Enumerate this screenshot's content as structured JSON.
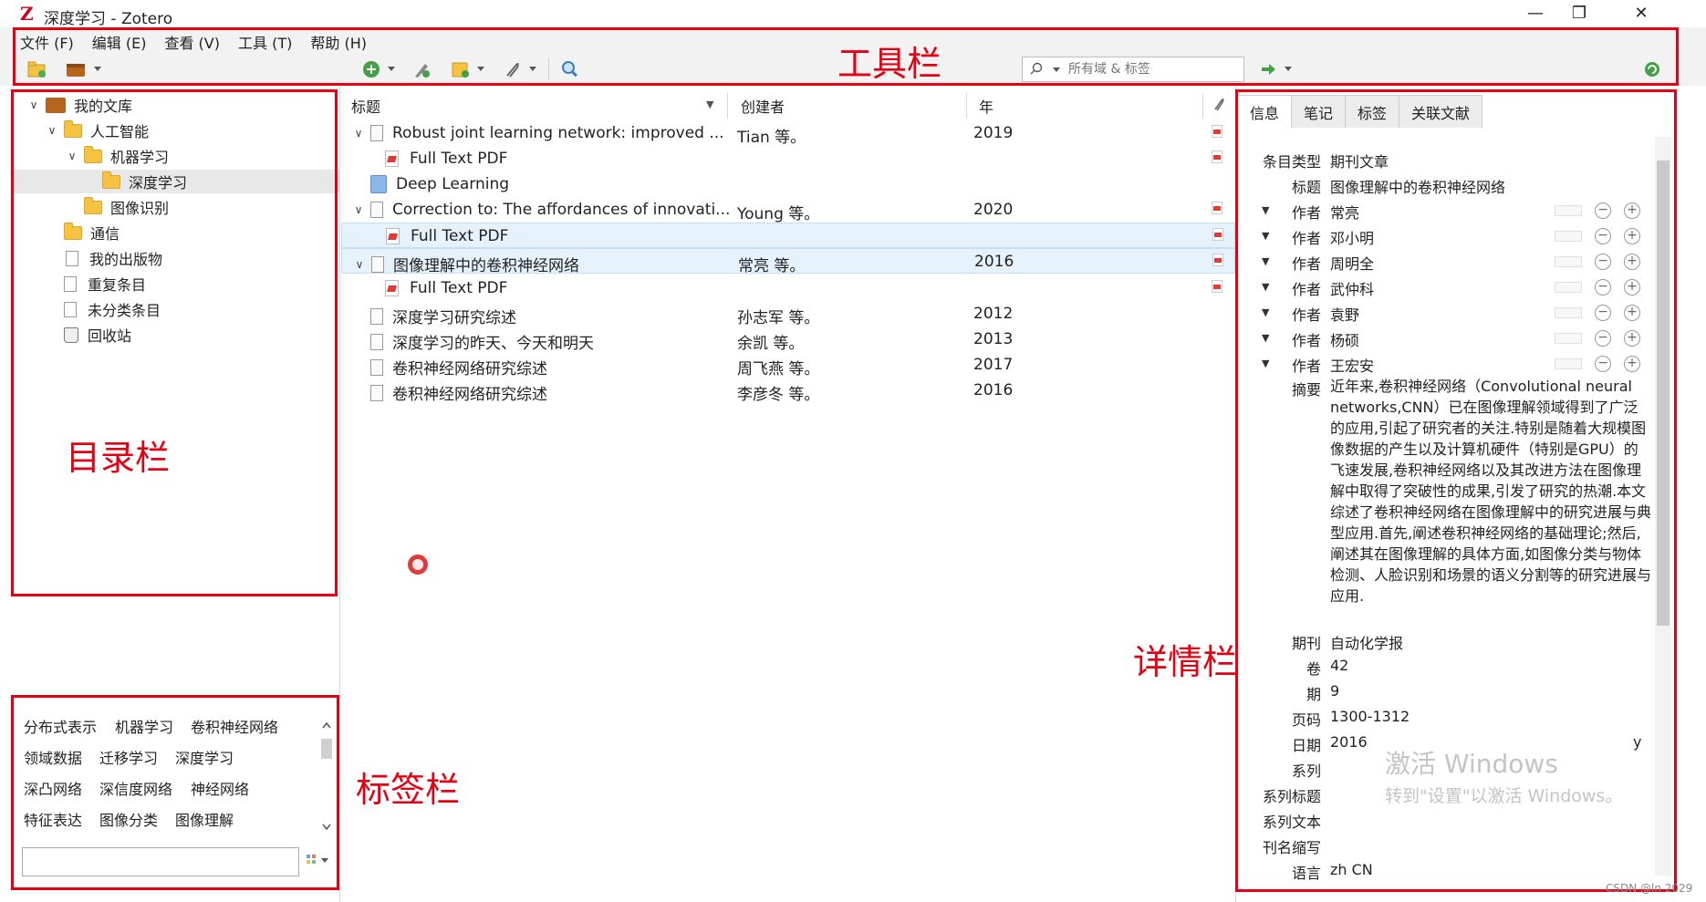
{
  "window": {
    "title": "深度学习 - Zotero",
    "app_icon_glyph": "Z",
    "minimize_glyph": "—",
    "restore_glyph": "❐",
    "close_glyph": "✕"
  },
  "menu": [
    "文件 (F)",
    "编辑 (E)",
    "查看 (V)",
    "工具 (T)",
    "帮助 (H)"
  ],
  "search": {
    "placeholder": "所有域 & 标签"
  },
  "annotations": {
    "toolbar": "工具栏",
    "collections": "目录栏",
    "tags": "标签栏",
    "details": "详情栏"
  },
  "collections": [
    {
      "label": "我的文库",
      "level": 0,
      "icon": "library-icon",
      "twisty": "∨"
    },
    {
      "label": "人工智能",
      "level": 1,
      "icon": "folder-icon",
      "twisty": "∨"
    },
    {
      "label": "机器学习",
      "level": 2,
      "icon": "folder-icon",
      "twisty": "∨"
    },
    {
      "label": "深度学习",
      "level": 3,
      "icon": "folder-icon",
      "twisty": "",
      "selected": true
    },
    {
      "label": "图像识别",
      "level": 2,
      "icon": "folder-icon",
      "twisty": ""
    },
    {
      "label": "通信",
      "level": 1,
      "icon": "folder-icon",
      "twisty": ""
    },
    {
      "label": "我的出版物",
      "level": 1,
      "icon": "publications-icon",
      "twisty": ""
    },
    {
      "label": "重复条目",
      "level": 1,
      "icon": "duplicates-icon",
      "twisty": ""
    },
    {
      "label": "未分类条目",
      "level": 1,
      "icon": "unfiled-icon",
      "twisty": ""
    },
    {
      "label": "回收站",
      "level": 1,
      "icon": "trash-icon",
      "twisty": ""
    }
  ],
  "tags": [
    [
      "分布式表示",
      "机器学习",
      "卷积神经网络"
    ],
    [
      "领域数据",
      "迁移学习",
      "深度学习"
    ],
    [
      "深凸网络",
      "深信度网络",
      "神经网络"
    ],
    [
      "特征表达",
      "图像分类",
      "图像理解"
    ]
  ],
  "columns": {
    "title": "标题",
    "creator": "创建者",
    "year": "年"
  },
  "items": [
    {
      "type": "doc",
      "twisty": "∨",
      "title": "Robust joint learning network: improved ...",
      "creator": "Tian 等。",
      "year": "2019",
      "att": true,
      "indent": 0
    },
    {
      "type": "pdf",
      "twisty": "",
      "title": "Full Text PDF",
      "creator": "",
      "year": "",
      "att": true,
      "indent": 1
    },
    {
      "type": "book",
      "twisty": "",
      "title": "Deep Learning",
      "creator": "",
      "year": "",
      "att": false,
      "indent": 0
    },
    {
      "type": "doc",
      "twisty": "∨",
      "title": "Correction to: The affordances of innovati...",
      "creator": "Young 等。",
      "year": "2020",
      "att": true,
      "indent": 0
    },
    {
      "type": "pdf",
      "twisty": "",
      "title": "Full Text PDF",
      "creator": "",
      "year": "",
      "att": true,
      "indent": 1,
      "selected": true
    },
    {
      "type": "doc",
      "twisty": "∨",
      "title": "图像理解中的卷积神经网络",
      "creator": "常亮 等。",
      "year": "2016",
      "att": true,
      "indent": 0,
      "selected": true
    },
    {
      "type": "pdf",
      "twisty": "",
      "title": "Full Text PDF",
      "creator": "",
      "year": "",
      "att": true,
      "indent": 1
    },
    {
      "type": "doc",
      "twisty": "",
      "title": "深度学习研究综述",
      "creator": "孙志军 等。",
      "year": "2012",
      "att": false,
      "indent": 0
    },
    {
      "type": "doc",
      "twisty": "",
      "title": "深度学习的昨天、今天和明天",
      "creator": "余凯 等。",
      "year": "2013",
      "att": false,
      "indent": 0
    },
    {
      "type": "doc",
      "twisty": "",
      "title": "卷积神经网络研究综述",
      "creator": "周飞燕 等。",
      "year": "2017",
      "att": false,
      "indent": 0
    },
    {
      "type": "doc",
      "twisty": "",
      "title": "卷积神经网络研究综述",
      "creator": "李彦冬 等。",
      "year": "2016",
      "att": false,
      "indent": 0
    }
  ],
  "detail_tabs": [
    "信息",
    "笔记",
    "标签",
    "关联文献"
  ],
  "info": {
    "item_type_label": "条目类型",
    "item_type": "期刊文章",
    "title_label": "标题",
    "title": "图像理解中的卷积神经网络",
    "creator_label": "作者",
    "creators": [
      "常亮",
      "邓小明",
      "周明全",
      "武仲科",
      "袁野",
      "杨硕",
      "王宏安"
    ],
    "abstract_label": "摘要",
    "abstract": "近年来,卷积神经网络（Convolutional neural networks,CNN）已在图像理解领域得到了广泛的应用,引起了研究者的关注.特别是随着大规模图像数据的产生以及计算机硬件（特别是GPU）的飞速发展,卷积神经网络以及其改进方法在图像理解中取得了突破性的成果,引发了研究的热潮.本文综述了卷积神经网络在图像理解中的研究进展与典型应用.首先,阐述卷积神经网络的基础理论;然后,阐述其在图像理解的具体方面,如图像分类与物体检测、人脸识别和场景的语义分割等的研究进展与应用.",
    "fields": [
      {
        "label": "期刊",
        "value": "自动化学报"
      },
      {
        "label": "卷",
        "value": "42"
      },
      {
        "label": "期",
        "value": "9"
      },
      {
        "label": "页码",
        "value": "1300-1312"
      },
      {
        "label": "日期",
        "value": "2016"
      },
      {
        "label": "系列",
        "value": ""
      },
      {
        "label": "系列标题",
        "value": ""
      },
      {
        "label": "系列文本",
        "value": ""
      },
      {
        "label": "刊名缩写",
        "value": ""
      },
      {
        "label": "语言",
        "value": "zh CN"
      }
    ],
    "date_suffix": "y"
  },
  "watermark": {
    "line1": "激活 Windows",
    "line2": "转到\"设置\"以激活 Windows。"
  },
  "credit": "CSDN @ln 2029",
  "colors": {
    "annotation_red": "#e60012",
    "selection_blue": "#e6f2fb"
  }
}
